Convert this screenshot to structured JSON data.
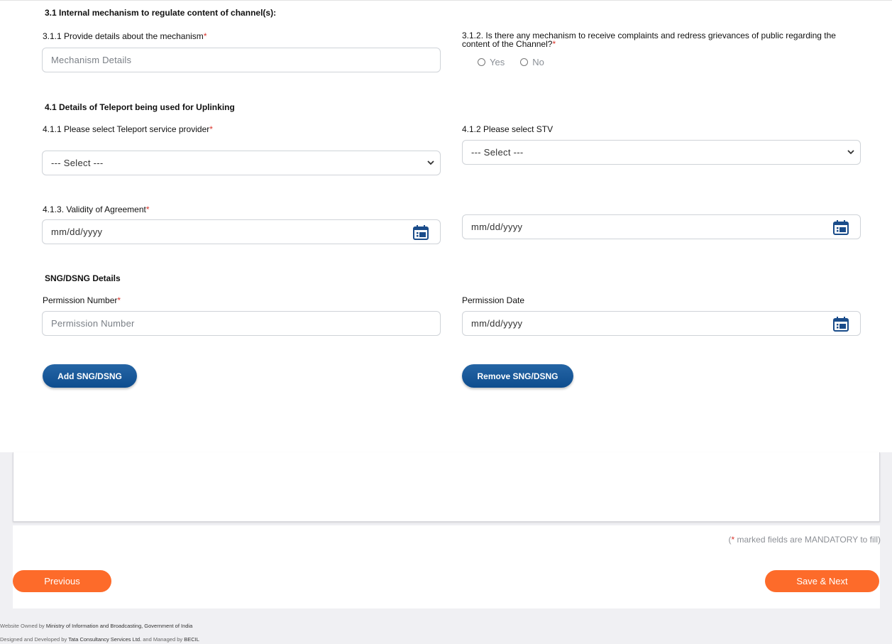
{
  "section31": {
    "heading": "3.1 Internal mechanism to regulate content of channel(s):",
    "q311_label": "3.1.1 Provide details about the mechanism",
    "q311_placeholder": "Mechanism Details",
    "q312_label_line1": "3.1.2. Is there any mechanism to receive complaints and redress grievances of public regarding the",
    "q312_label_line2": "content of the Channel?",
    "radio_yes": "Yes",
    "radio_no": "No"
  },
  "section41": {
    "heading": "4.1 Details of Teleport being used for Uplinking",
    "q411_label": "4.1.1 Please select Teleport service provider",
    "q411_value": "--- Select ---",
    "q412_label": "4.1.2 Please select STV",
    "q412_value": "--- Select ---",
    "q413_label": "4.1.3. Validity of Agreement",
    "date_from": "mm/dd/yyyy",
    "date_to": "mm/dd/yyyy"
  },
  "sng": {
    "heading": "SNG/DSNG Details",
    "permission_number_label": "Permission Number",
    "permission_number_placeholder": "Permission Number",
    "permission_date_label": "Permission Date",
    "permission_date_value": "mm/dd/yyyy",
    "add_button": "Add SNG/DSNG",
    "remove_button": "Remove SNG/DSNG"
  },
  "form_footer": {
    "mandatory_open": "(",
    "mandatory_star": "*",
    "mandatory_rest": " marked fields are MANDATORY to fill)",
    "previous_button": "Previous",
    "save_next_button": "Save & Next"
  },
  "site_footer": {
    "owned_prefix": "Website Owned by ",
    "owned_org": "Ministry of Information and Broadcasting, Government of India",
    "designed_prefix": "Designed and Developed by ",
    "designed_org": "Tata Consultancy Services Ltd.",
    "managed_text": " and Managed by ",
    "managed_org": "BECIL"
  },
  "required_marker": "*",
  "colors": {
    "required": "#d9342b",
    "primary_button": "#0e4d8e",
    "accent_button": "#fd6b2a"
  }
}
